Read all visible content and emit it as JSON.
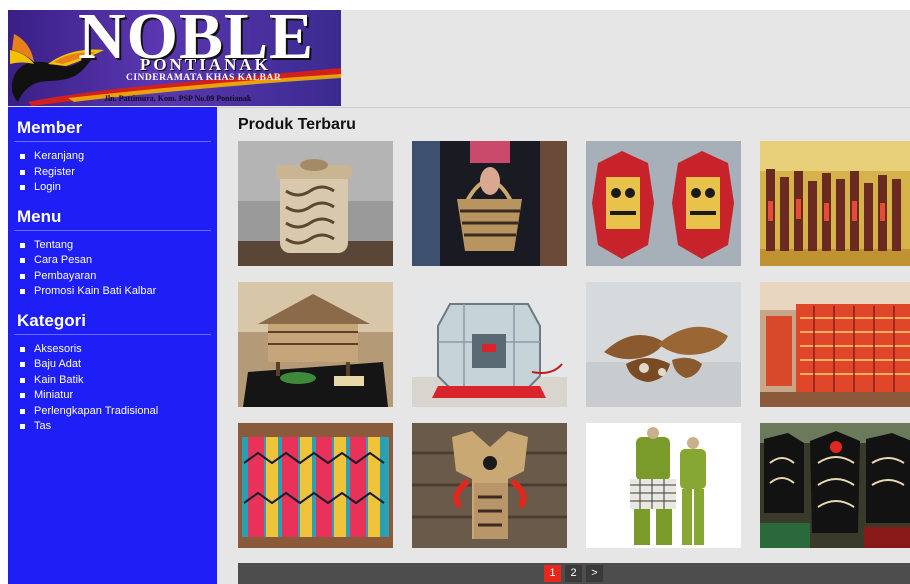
{
  "header": {
    "logo_title": "NOBLE",
    "logo_subtitle": "PONTIANAK",
    "logo_tagline": "CINDERAMATA KHAS KALBAR",
    "logo_address": "Jln. Pattimura, Kom. PSP No.09 Pontianak"
  },
  "sidebar": {
    "sections": [
      {
        "title": "Member",
        "items": [
          "Keranjang",
          "Register",
          "Login"
        ]
      },
      {
        "title": "Menu",
        "items": [
          "Tentang",
          "Cara Pesan",
          "Pembayaran",
          "Promosi Kain Bati Kalbar"
        ]
      },
      {
        "title": "Kategori",
        "items": [
          "Aksesoris",
          "Baju Adat",
          "Kain Batik",
          "Miniatur",
          "Perlengkapan Tradisional",
          "Tas"
        ]
      }
    ]
  },
  "main": {
    "title": "Produk Terbaru",
    "products": [
      {
        "subject": "carved-woven-basket-with-lid"
      },
      {
        "subject": "woven-handbag-held-by-person"
      },
      {
        "subject": "pair-of-red-dayak-shields"
      },
      {
        "subject": "row-of-carved-mandau-swords"
      },
      {
        "subject": "miniature-longhouse-model"
      },
      {
        "subject": "glass-hexagon-display-case"
      },
      {
        "subject": "wooden-arowana-fish-carvings"
      },
      {
        "subject": "red-songket-cloth-display"
      },
      {
        "subject": "colorful-woven-batik-panel"
      },
      {
        "subject": "beaded-traditional-vest"
      },
      {
        "subject": "green-baju-adat-outfits"
      },
      {
        "subject": "black-embroidered-dayak-costumes"
      }
    ]
  },
  "pagination": {
    "pages": [
      "1",
      "2"
    ],
    "next_label": ">",
    "active": "1"
  },
  "colors": {
    "sidebar_bg": "#1e1ef7",
    "page_bg": "#e6e6e6",
    "pager_bg": "#4d4d4d",
    "pager_active": "#e8261c"
  }
}
